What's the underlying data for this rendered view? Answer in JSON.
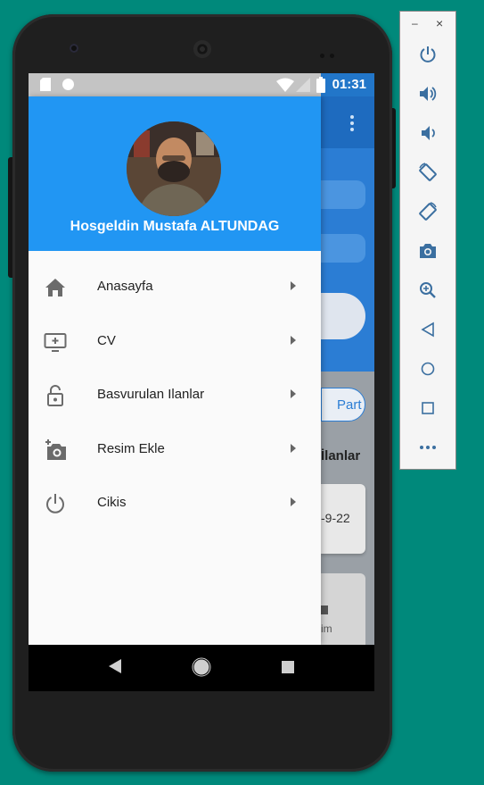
{
  "emulator": {
    "toolbar": {
      "minimize_label": "–",
      "close_label": "×",
      "buttons": [
        "power-icon",
        "volume-up-icon",
        "volume-down-icon",
        "rotate-left-icon",
        "rotate-right-icon",
        "camera-icon",
        "zoom-icon",
        "back-icon",
        "home-icon",
        "overview-icon",
        "more-icon"
      ]
    }
  },
  "statusbar": {
    "time": "01:31"
  },
  "background_app": {
    "chip_label": "Part",
    "section_title": "İlanlar",
    "card_date": "-9-22",
    "nav_label": "im"
  },
  "drawer": {
    "greeting": "Hosgeldin Mustafa ALTUNDAG",
    "header_color": "#2196f3",
    "items": [
      {
        "label": "Anasayfa",
        "icon": "home-icon"
      },
      {
        "label": "CV",
        "icon": "cv-screen-icon"
      },
      {
        "label": "Basvurulan Ilanlar",
        "icon": "lock-open-icon"
      },
      {
        "label": "Resim Ekle",
        "icon": "add-camera-icon"
      },
      {
        "label": "Cikis",
        "icon": "power-icon"
      }
    ]
  },
  "colors": {
    "desktop": "#00897b",
    "appbar": "#1e6bbf",
    "accent": "#2196f3"
  }
}
